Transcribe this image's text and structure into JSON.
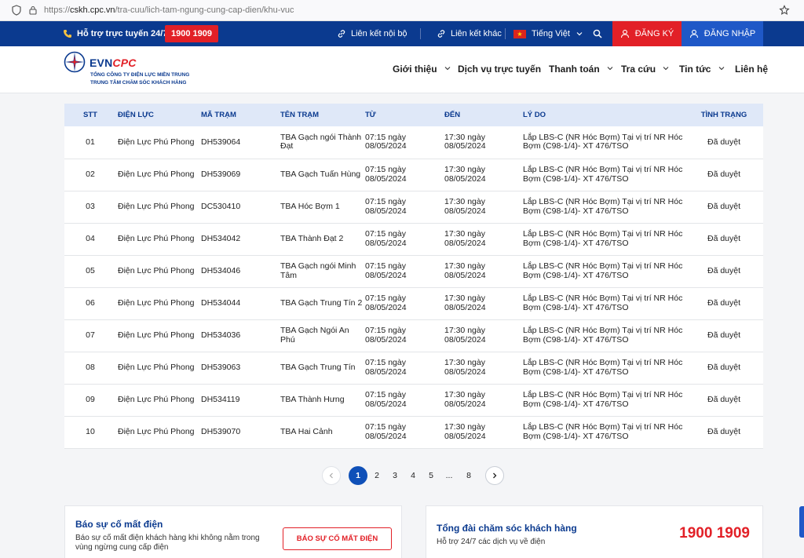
{
  "browser": {
    "url_prefix": "https://",
    "url_host": "cskh.cpc.vn",
    "url_path": "/tra-cuu/lich-tam-ngung-cung-cap-dien/khu-vuc"
  },
  "topbar": {
    "support_label": "Hỗ trợ trực tuyến 24/7:",
    "hotline": "1900 1909",
    "internal_link": "Liên kết nội bộ",
    "other_link": "Liên kết khác",
    "language": "Tiếng Việt",
    "register": "ĐĂNG KÝ",
    "login": "ĐĂNG NHẬP"
  },
  "logo": {
    "brand_a": "EVN",
    "brand_b": "CPC",
    "line1": "TỔNG CÔNG TY ĐIỆN LỰC MIỀN TRUNG",
    "line2": "TRUNG TÂM CHĂM SÓC KHÁCH HÀNG"
  },
  "nav": {
    "about": "Giới thiệu",
    "online_services": "Dịch vụ trực tuyến",
    "payment": "Thanh toán",
    "lookup": "Tra cứu",
    "news": "Tin tức",
    "contact": "Liên hệ"
  },
  "table": {
    "headers": {
      "stt": "STT",
      "dien_luc": "ĐIỆN LỰC",
      "ma_tram": "MÃ TRẠM",
      "ten_tram": "TÊN TRẠM",
      "tu": "TỪ",
      "den": "ĐẾN",
      "ly_do": "LÝ DO",
      "tinh_trang": "TÌNH TRẠNG"
    },
    "rows": [
      {
        "stt": "01",
        "dien_luc": "Điện Lực Phú Phong",
        "ma_tram": "DH539064",
        "ten_tram": "TBA Gạch ngói Thành Đạt",
        "tu": "07:15 ngày 08/05/2024",
        "den": "17:30 ngày 08/05/2024",
        "ly_do": "Lắp LBS-C (NR Hóc Bợm) Tại vị trí NR Hóc Bợm (C98-1/4)- XT 476/TSO",
        "tinh_trang": "Đã duyệt"
      },
      {
        "stt": "02",
        "dien_luc": "Điện Lực Phú Phong",
        "ma_tram": "DH539069",
        "ten_tram": "TBA Gạch Tuấn Hùng",
        "tu": "07:15 ngày 08/05/2024",
        "den": "17:30 ngày 08/05/2024",
        "ly_do": "Lắp LBS-C (NR Hóc Bợm) Tại vị trí NR Hóc Bợm (C98-1/4)- XT 476/TSO",
        "tinh_trang": "Đã duyệt"
      },
      {
        "stt": "03",
        "dien_luc": "Điện Lực Phú Phong",
        "ma_tram": "DC530410",
        "ten_tram": "TBA Hóc Bợm 1",
        "tu": "07:15 ngày 08/05/2024",
        "den": "17:30 ngày 08/05/2024",
        "ly_do": "Lắp LBS-C (NR Hóc Bợm) Tại vị trí NR Hóc Bợm (C98-1/4)- XT 476/TSO",
        "tinh_trang": "Đã duyệt"
      },
      {
        "stt": "04",
        "dien_luc": "Điện Lực Phú Phong",
        "ma_tram": "DH534042",
        "ten_tram": "TBA Thành Đạt 2",
        "tu": "07:15 ngày 08/05/2024",
        "den": "17:30 ngày 08/05/2024",
        "ly_do": "Lắp LBS-C (NR Hóc Bợm) Tại vị trí NR Hóc Bợm (C98-1/4)- XT 476/TSO",
        "tinh_trang": "Đã duyệt"
      },
      {
        "stt": "05",
        "dien_luc": "Điện Lực Phú Phong",
        "ma_tram": "DH534046",
        "ten_tram": "TBA Gạch ngói Minh Tâm",
        "tu": "07:15 ngày 08/05/2024",
        "den": "17:30 ngày 08/05/2024",
        "ly_do": "Lắp LBS-C (NR Hóc Bợm) Tại vị trí NR Hóc Bợm (C98-1/4)- XT 476/TSO",
        "tinh_trang": "Đã duyệt"
      },
      {
        "stt": "06",
        "dien_luc": "Điện Lực Phú Phong",
        "ma_tram": "DH534044",
        "ten_tram": "TBA Gạch Trung Tín 2",
        "tu": "07:15 ngày 08/05/2024",
        "den": "17:30 ngày 08/05/2024",
        "ly_do": "Lắp LBS-C (NR Hóc Bợm) Tại vị trí NR Hóc Bợm (C98-1/4)- XT 476/TSO",
        "tinh_trang": "Đã duyệt"
      },
      {
        "stt": "07",
        "dien_luc": "Điện Lực Phú Phong",
        "ma_tram": "DH534036",
        "ten_tram": "TBA Gạch Ngói An Phú",
        "tu": "07:15 ngày 08/05/2024",
        "den": "17:30 ngày 08/05/2024",
        "ly_do": "Lắp LBS-C (NR Hóc Bợm) Tại vị trí NR Hóc Bợm (C98-1/4)- XT 476/TSO",
        "tinh_trang": "Đã duyệt"
      },
      {
        "stt": "08",
        "dien_luc": "Điện Lực Phú Phong",
        "ma_tram": "DH539063",
        "ten_tram": "TBA Gạch Trung Tín",
        "tu": "07:15 ngày 08/05/2024",
        "den": "17:30 ngày 08/05/2024",
        "ly_do": "Lắp LBS-C (NR Hóc Bợm) Tại vị trí NR Hóc Bợm (C98-1/4)- XT 476/TSO",
        "tinh_trang": "Đã duyệt"
      },
      {
        "stt": "09",
        "dien_luc": "Điện Lực Phú Phong",
        "ma_tram": "DH534119",
        "ten_tram": "TBA Thành Hưng",
        "tu": "07:15 ngày 08/05/2024",
        "den": "17:30 ngày 08/05/2024",
        "ly_do": "Lắp LBS-C (NR Hóc Bợm) Tại vị trí NR Hóc Bợm (C98-1/4)- XT 476/TSO",
        "tinh_trang": "Đã duyệt"
      },
      {
        "stt": "10",
        "dien_luc": "Điện Lực Phú Phong",
        "ma_tram": "DH539070",
        "ten_tram": "TBA Hai Cảnh",
        "tu": "07:15 ngày 08/05/2024",
        "den": "17:30 ngày 08/05/2024",
        "ly_do": "Lắp LBS-C (NR Hóc Bợm) Tại vị trí NR Hóc Bợm (C98-1/4)- XT 476/TSO",
        "tinh_trang": "Đã duyệt"
      }
    ]
  },
  "pagination": {
    "pages": [
      "1",
      "2",
      "3",
      "4",
      "5",
      "...",
      "8"
    ],
    "current": "1"
  },
  "report_card": {
    "title": "Báo sự cố mất điện",
    "desc": "Báo sự cố mất điện khách hàng khi không nằm trong vùng ngừng cung cấp điện",
    "button": "BÁO SỰ CỐ MẤT ĐIỆN"
  },
  "hotline_card": {
    "title": "Tổng đài chăm sóc khách hàng",
    "desc": "Hỗ trợ 24/7 các dịch vụ về điện",
    "number": "1900 1909"
  },
  "colors": {
    "primary": "#0b3a8f",
    "accent": "#e22027",
    "login_bg": "#1f58c7",
    "table_header_bg": "#dfe8f8"
  }
}
